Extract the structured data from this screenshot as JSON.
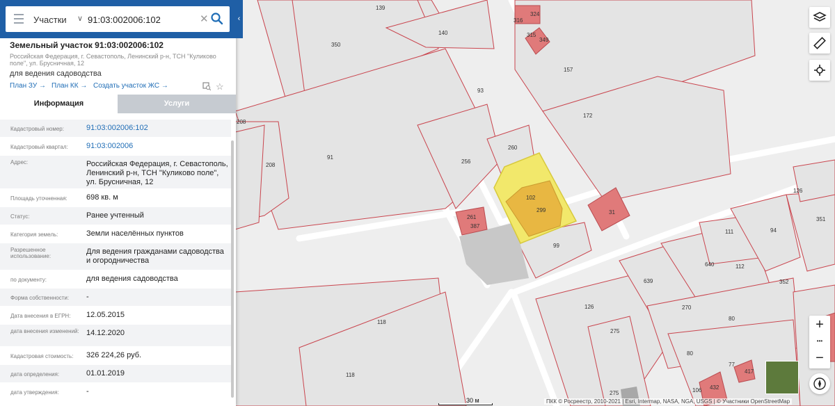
{
  "search": {
    "category": "Участки",
    "query": "91:03:002006:102"
  },
  "card": {
    "title": "Земельный участок 91:03:002006:102",
    "address": "Российская Федерация, г. Севастополь, Ленинский р-н, ТСН \"Куликово поле\", ул. Брусничная, 12",
    "purpose": "для ведения садоводства",
    "links": [
      "План ЗУ →",
      "План КК →",
      "Создать участок ЖС →"
    ]
  },
  "tabs": [
    "Информация",
    "Услуги"
  ],
  "fields": [
    {
      "label": "Кадастровый номер:",
      "value": "91:03:002006:102",
      "link": true
    },
    {
      "label": "Кадастровый квартал:",
      "value": "91:03:002006",
      "link": true
    },
    {
      "label": "Адрес:",
      "value": "Российская Федерация, г. Севастополь, Ленинский р-н, ТСН \"Куликово поле\", ул. Брусничная, 12"
    },
    {
      "label": "Площадь уточненная:",
      "value": "698 кв. м"
    },
    {
      "label": "Статус:",
      "value": "Ранее учтенный"
    },
    {
      "label": "Категория земель:",
      "value": "Земли населённых пунктов"
    },
    {
      "label": "Разрешенное использование:",
      "value": "Для ведения гражданами садоводства и огородничества"
    },
    {
      "label": "по документу:",
      "value": "для ведения садоводства"
    },
    {
      "label": "Форма собственности:",
      "value": "-"
    },
    {
      "label": "Дата внесения в ЕГРН:",
      "value": "12.05.2015"
    },
    {
      "label": "дата внесения изменений:",
      "value": "14.12.2020"
    },
    {
      "label": "Кадастровая стоимость:",
      "value": "326 224,26 руб."
    },
    {
      "label": "дата определения:",
      "value": "01.01.2019"
    },
    {
      "label": "дата утверждения:",
      "value": "-"
    }
  ],
  "map": {
    "parcels": [
      "139",
      "324",
      "316",
      "315",
      "349",
      "140",
      "350",
      "157",
      "93",
      "172",
      "208",
      "91",
      "260",
      "256",
      "102",
      "299",
      "31",
      "126",
      "351",
      "261",
      "387",
      "111",
      "94",
      "99",
      "640",
      "112",
      "639",
      "352",
      "270",
      "80",
      "126",
      "118",
      "275",
      "77",
      "417",
      "106",
      "432",
      "190",
      "118",
      "80"
    ],
    "scale": "30 м",
    "attribution": "ПКК © Росреестр, 2010-2021 | Esri, Intermap, NASA, NGA, USGS | © Участники OpenStreetMap",
    "selected_color": "#f2e86b",
    "building_color": "#e07a7a",
    "boundary_color": "#c9444d"
  },
  "controls": {
    "zoom_in": "+",
    "zoom_out": "−",
    "more": "•••"
  }
}
